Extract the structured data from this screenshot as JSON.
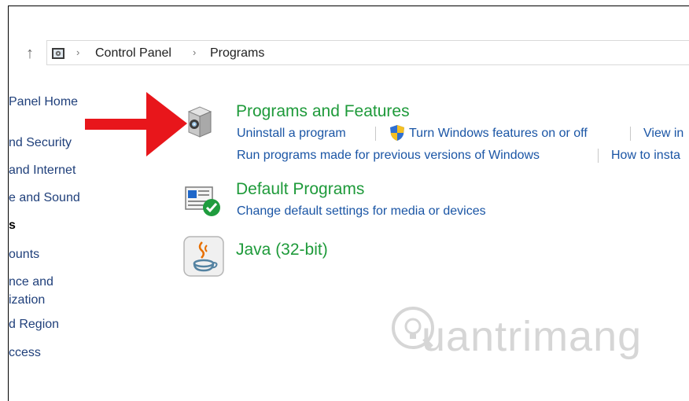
{
  "toolbar": {
    "up_arrow": "↑",
    "breadcrumb": [
      "Control Panel",
      "Programs"
    ],
    "separator": "›"
  },
  "sidebar": {
    "items": [
      {
        "label": "Panel Home",
        "bold": false
      },
      {
        "label": "nd Security",
        "bold": false
      },
      {
        "label": " and Internet",
        "bold": false
      },
      {
        "label": "e and Sound",
        "bold": false
      },
      {
        "label": "s",
        "bold": true
      },
      {
        "label": "ounts",
        "bold": false
      },
      {
        "label": "nce and",
        "bold": false
      },
      {
        "label": "ization",
        "bold": false
      },
      {
        "label": "d Region",
        "bold": false
      },
      {
        "label": "ccess",
        "bold": false
      }
    ]
  },
  "main": {
    "categories": [
      {
        "title": "Programs and Features",
        "icon": "programs-features-icon",
        "links_row1": [
          "Uninstall a program",
          "Turn Windows features on or off",
          "View in"
        ],
        "links_row2": [
          "Run programs made for previous versions of Windows",
          "How to insta"
        ]
      },
      {
        "title": "Default Programs",
        "icon": "default-programs-icon",
        "links_row1": [
          "Change default settings for media or devices"
        ]
      },
      {
        "title": "Java (32-bit)",
        "icon": "java-icon"
      }
    ]
  },
  "overlay": {
    "annotation": "red-arrow",
    "annotation_color": "#e8161b",
    "watermark": "uantrimang"
  },
  "colors": {
    "category_title": "#1e9a3a",
    "link": "#1a55a5",
    "sidebar_link": "#1f3f7a"
  }
}
